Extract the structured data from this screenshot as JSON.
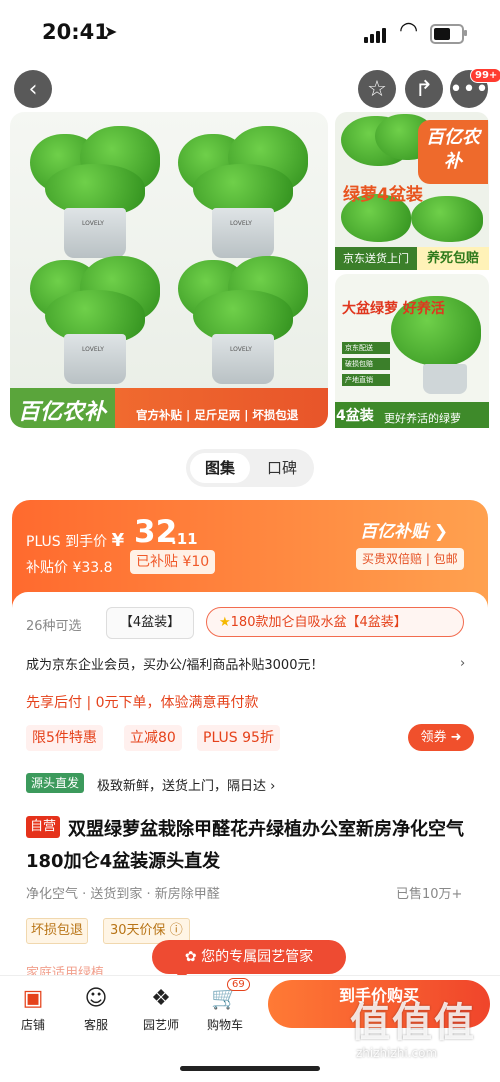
{
  "status": {
    "time": "20:41"
  },
  "nav": {
    "more_badge": "99+"
  },
  "gallery": {
    "main_brand": "百亿农补",
    "main_slogan": "官方补贴 | 足斤足两 | 坏损包退",
    "side1_brand": "百亿农补",
    "side1_title": "绿萝4盆装",
    "side1_left": "京东送货上门",
    "side1_right": "养死包赔",
    "side2_title": "大盆绿萝 好养活",
    "side2_chips": [
      "京东配送",
      "破损包赔",
      "产地直销"
    ],
    "side2_count": "4盆装",
    "side2_slogan": "更好养活的绿萝"
  },
  "tabs": [
    "图集",
    "口碑"
  ],
  "price": {
    "plus_label": "PLUS 到手价",
    "currency": "¥",
    "integer": "32",
    "decimal": ".11",
    "subsidy_label": "补贴价 ¥33.8",
    "subsidy_tag": "已补贴 ¥10",
    "brand": "百亿补贴",
    "brand_tag": "买贵双倍赔 | 包邮"
  },
  "options": {
    "count": "26种可选",
    "opt1": "【4盆装】",
    "opt2": "180款加仑自吸水盆【4盆装】"
  },
  "promo": {
    "text": "成为京东企业会员，买办公/福利商品补贴3000元！",
    "arrow": "›"
  },
  "paylater": "先享后付 | 0元下单，体验满意再付款",
  "chips": [
    "限5件特惠",
    "立减80",
    "PLUS 95折"
  ],
  "coupon": "领券",
  "source": {
    "tag": "源头直发",
    "text": "极致新鲜，送货上门，隔日达 ›"
  },
  "product": {
    "self_tag": "自营",
    "title": "双盟绿萝盆栽除甲醛花卉绿植办公室新房净化空气180加仑4盆装源头直发",
    "features": "净化空气 · 送货到家 · 新房除甲醛",
    "sold": "已售10万+"
  },
  "guarantee": [
    "坏损包退",
    "30天价保"
  ],
  "faded": "家庭适用绿植",
  "pill": "您的专属园艺管家",
  "bottom": {
    "items": [
      "店铺",
      "客服",
      "园艺师",
      "购物车"
    ],
    "cart_badge": "69",
    "buy": "到手价购买"
  },
  "watermark": {
    "brand": "值值值",
    "url": "zhizhizhi.com"
  },
  "colors": {
    "accent": "#f0502c",
    "green": "#5aa53b"
  }
}
